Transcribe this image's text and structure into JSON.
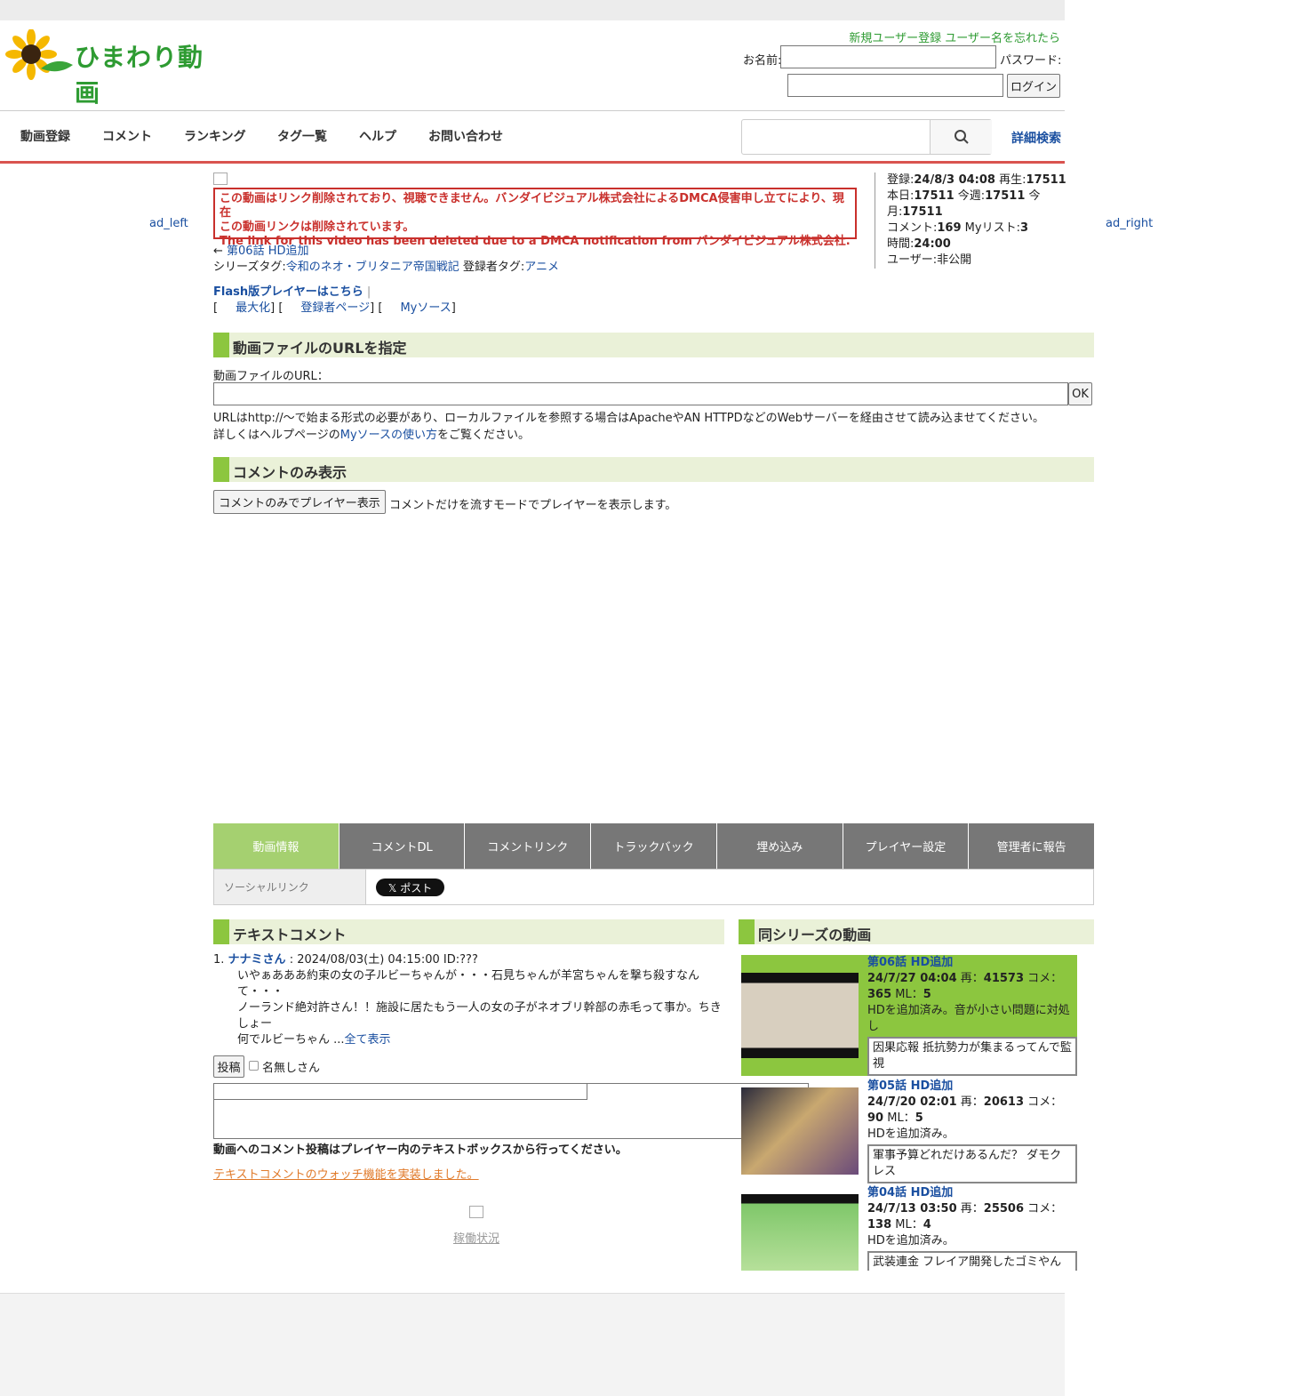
{
  "header": {
    "logo_text": "ひまわり動画",
    "register_link": "新規ユーザー登録",
    "forgot_link": "ユーザー名を忘れたら",
    "name_label": "お名前:",
    "password_label": "パスワード:",
    "login_button": "ログイン"
  },
  "nav": {
    "items": [
      "動画登録",
      "コメント",
      "ランキング",
      "タグ一覧",
      "ヘルプ",
      "お問い合わせ"
    ],
    "detail_search": "詳細検索"
  },
  "ads": {
    "left": "ad_left",
    "right": "ad_right"
  },
  "notice": {
    "line1": "この動画はリンク削除されており、視聴できません。バンダイビジュアル株式会社によるDMCA侵害申し立てにより、現在",
    "line2": "この動画リンクは削除されています。",
    "line3": "The link for this video has been deleted due to a DMCA notification from バンダイビジュアル株式会社."
  },
  "stats": {
    "reg_label": "登録:",
    "reg_value": "24/8/3 04:08",
    "play_label": " 再生:",
    "play_value": "17511",
    "today_label": "本日:",
    "today_value": "17511",
    "week_label": " 今週:",
    "week_value": "17511",
    "month_label": " 今月:",
    "month_value": "17511",
    "comment_label": "コメント:",
    "comment_value": "169",
    "mylist_label": " Myリスト:",
    "mylist_value": "3",
    "time_label": "時間:",
    "time_value": "24:00",
    "user_label": "ユーザー:",
    "user_value": "非公開"
  },
  "video": {
    "prev_arrow": "← ",
    "prev_link": "第06話 HD追加",
    "series_tag_label": "シリーズタグ:",
    "series_tag": "令和のネオ・ブリタニア帝国戦記",
    "reg_tag_label": " 登録者タグ:",
    "reg_tag": "アニメ",
    "flash_link": "Flash版プレイヤーはこちら",
    "sep": " |",
    "bracket_open": "[",
    "maximize": "最大化",
    "uploader_page": "登録者ページ",
    "mysource": "Myソース",
    "bracket_close": "]"
  },
  "url_section": {
    "heading": "動画ファイルのURLを指定",
    "label": "動画ファイルのURL：",
    "ok_button": "OK",
    "note1": "URLはhttp://〜で始まる形式の必要があり、ローカルファイルを参照する場合はApacheやAN HTTPDなどのWebサーバーを経由させて読み込ませてください。",
    "note2_pre": "詳しくはヘルプページの",
    "note2_link": "Myソースの使い方",
    "note2_post": "をご覧ください。"
  },
  "comment_only": {
    "heading": "コメントのみ表示",
    "button": "コメントのみでプレイヤー表示",
    "desc": "コメントだけを流すモードでプレイヤーを表示します。"
  },
  "tabs": [
    "動画情報",
    "コメントDL",
    "コメントリンク",
    "トラックバック",
    "埋め込み",
    "プレイヤー設定",
    "管理者に報告"
  ],
  "social": {
    "label": "ソーシャルリンク",
    "x_post": "𝕏 ポスト"
  },
  "text_comments": {
    "heading": "テキストコメント",
    "num": "1. ",
    "author": "ナナミさん",
    "meta": " : 2024/08/03(土) 04:15:00 ID:???",
    "line1": "いやぁあああ約束の女の子ルビーちゃんが・・・石見ちゃんが羊宮ちゃんを撃ち殺すなんて・・・",
    "line2": "ノーランド絶対許さん！！施設に居たもう一人の女の子がネオブリ幹部の赤毛って事か。ちきしょー",
    "line3": "何でルビーちゃん ...",
    "show_all": "全て表示",
    "post_button": "投稿",
    "anon_label": "名無しさん",
    "instruction": "動画へのコメント投稿はプレイヤー内のテキストボックスから行ってください。",
    "watch_link": "テキストコメントのウォッチ機能を実装しました。",
    "status_link": "稼働状況"
  },
  "series": {
    "heading": "同シリーズの動画",
    "items": [
      {
        "title": "第06話 HD追加",
        "date": "24/7/27 04:04",
        "play_label": " 再：",
        "play": "41573",
        "com_label": " コメ：",
        "com": "365",
        "ml_label": " ML：",
        "ml": "5",
        "desc": "HDを追加済み。音が小さい問題に対処し",
        "comment": "因果応報 抵抗勢力が集まるってんで監視"
      },
      {
        "title": "第05話 HD追加",
        "date": "24/7/20 02:01",
        "play_label": " 再：",
        "play": "20613",
        "com_label": " コメ：",
        "com": "90",
        "ml_label": " ML：",
        "ml": "5",
        "desc": "HDを追加済み。",
        "comment": "軍事予算どれだけあるんだ？ ダモクレス"
      },
      {
        "title": "第04話 HD追加",
        "date": "24/7/13 03:50",
        "play_label": " 再：",
        "play": "25506",
        "com_label": " コメ：",
        "com": "138",
        "ml_label": " ML：",
        "ml": "4",
        "desc": "HDを追加済み。",
        "comment": "武装連金 フレイア開発したゴミやん"
      }
    ]
  },
  "colors": {
    "accent_green": "#8cc63f",
    "nav_red": "#d9534f",
    "notice_red": "#c9302c",
    "link_blue": "#1a4fa0",
    "logo_green": "#2e9b32"
  }
}
